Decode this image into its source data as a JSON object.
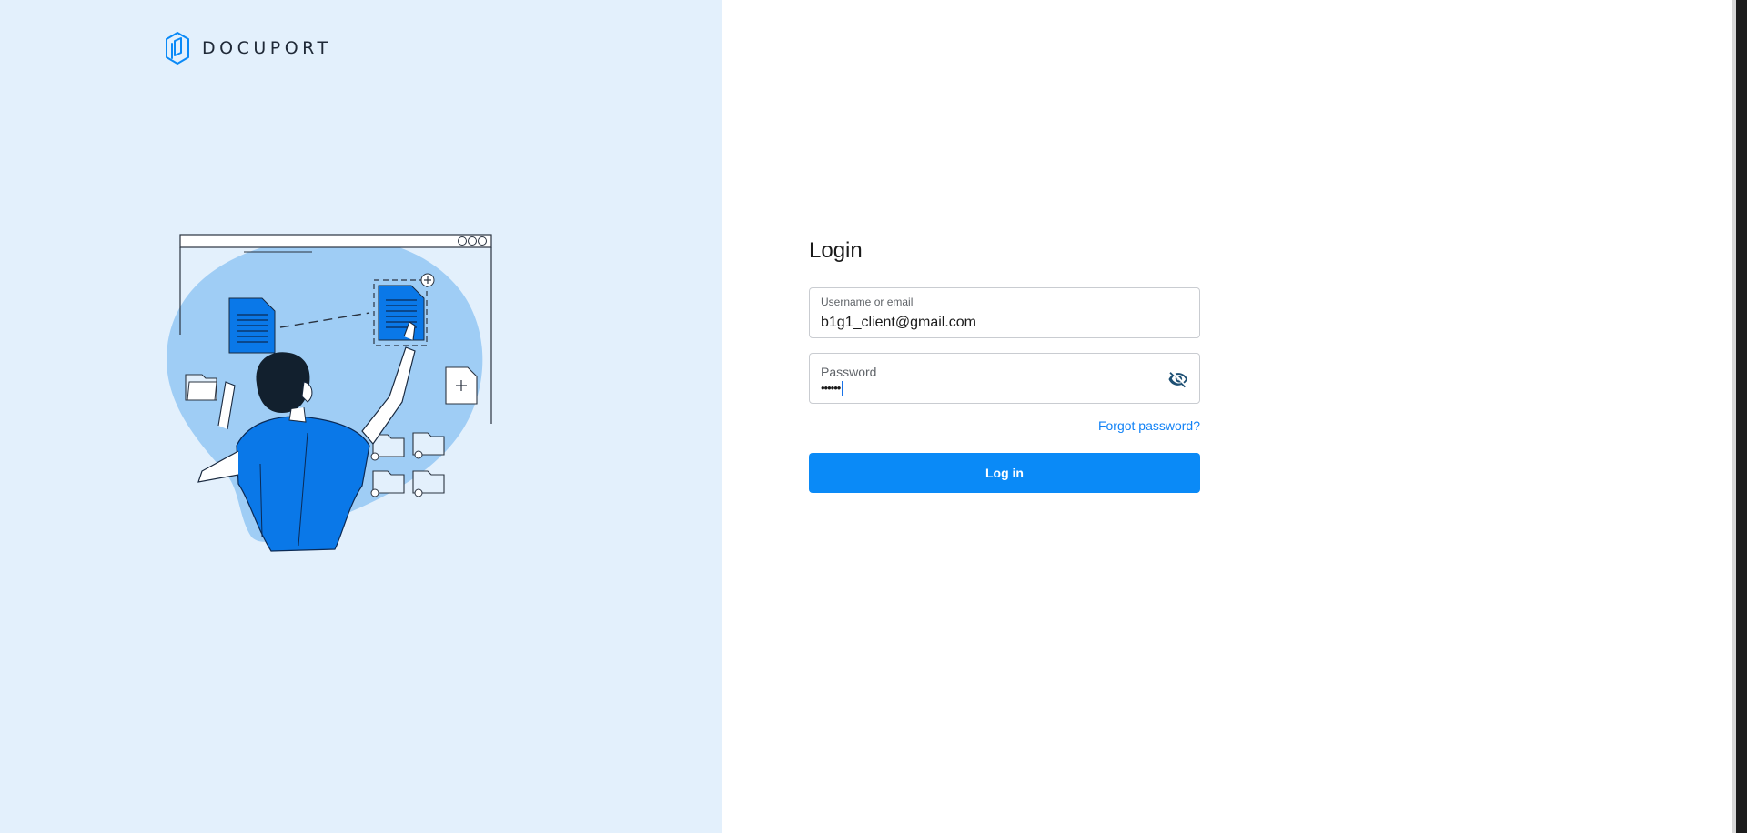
{
  "brand": {
    "name": "DOCUPORT",
    "logo_icon": "docuport-logo-icon",
    "accent_color": "#0a8af7",
    "panel_color": "#e3f0fc"
  },
  "illustration": {
    "icon": "person-organizing-documents-illustration"
  },
  "login": {
    "title": "Login",
    "username": {
      "label": "Username or email",
      "value": "b1g1_client@gmail.com"
    },
    "password": {
      "label": "Password",
      "masked_value": "••••••",
      "toggle_icon": "eye-off-icon"
    },
    "forgot_password": "Forgot password?",
    "submit_label": "Log in"
  }
}
